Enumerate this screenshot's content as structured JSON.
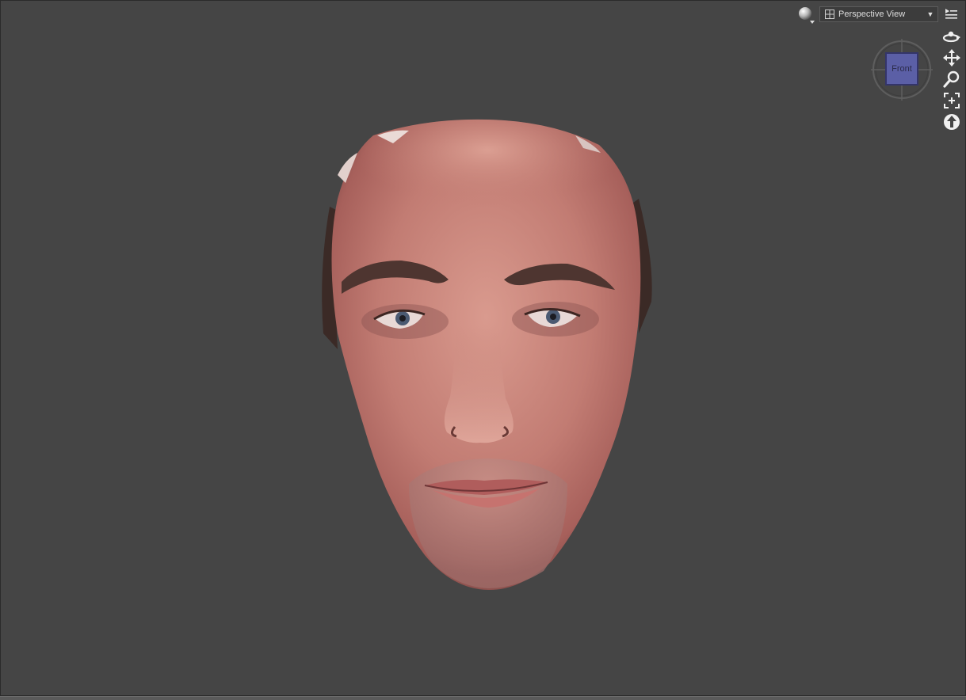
{
  "viewport": {
    "background_color": "#454545",
    "render_style_icon": "sphere-render-style-icon",
    "view_selector": {
      "selected": "Perspective View",
      "layout_icon": "single-pane-layout-icon",
      "dropdown_icon": "triangle-down-icon"
    },
    "options_icon": "pane-options-menu-icon",
    "view_cube": {
      "face_label": "Front",
      "face_color": "#5b5fa6"
    },
    "nav_tools": [
      {
        "name": "orbit-icon"
      },
      {
        "name": "pan-icon"
      },
      {
        "name": "zoom-icon"
      },
      {
        "name": "frame-icon"
      },
      {
        "name": "reset-view-icon"
      }
    ],
    "model": {
      "subject": "scanned-head-mesh",
      "skin_color": "#c07a72"
    }
  }
}
